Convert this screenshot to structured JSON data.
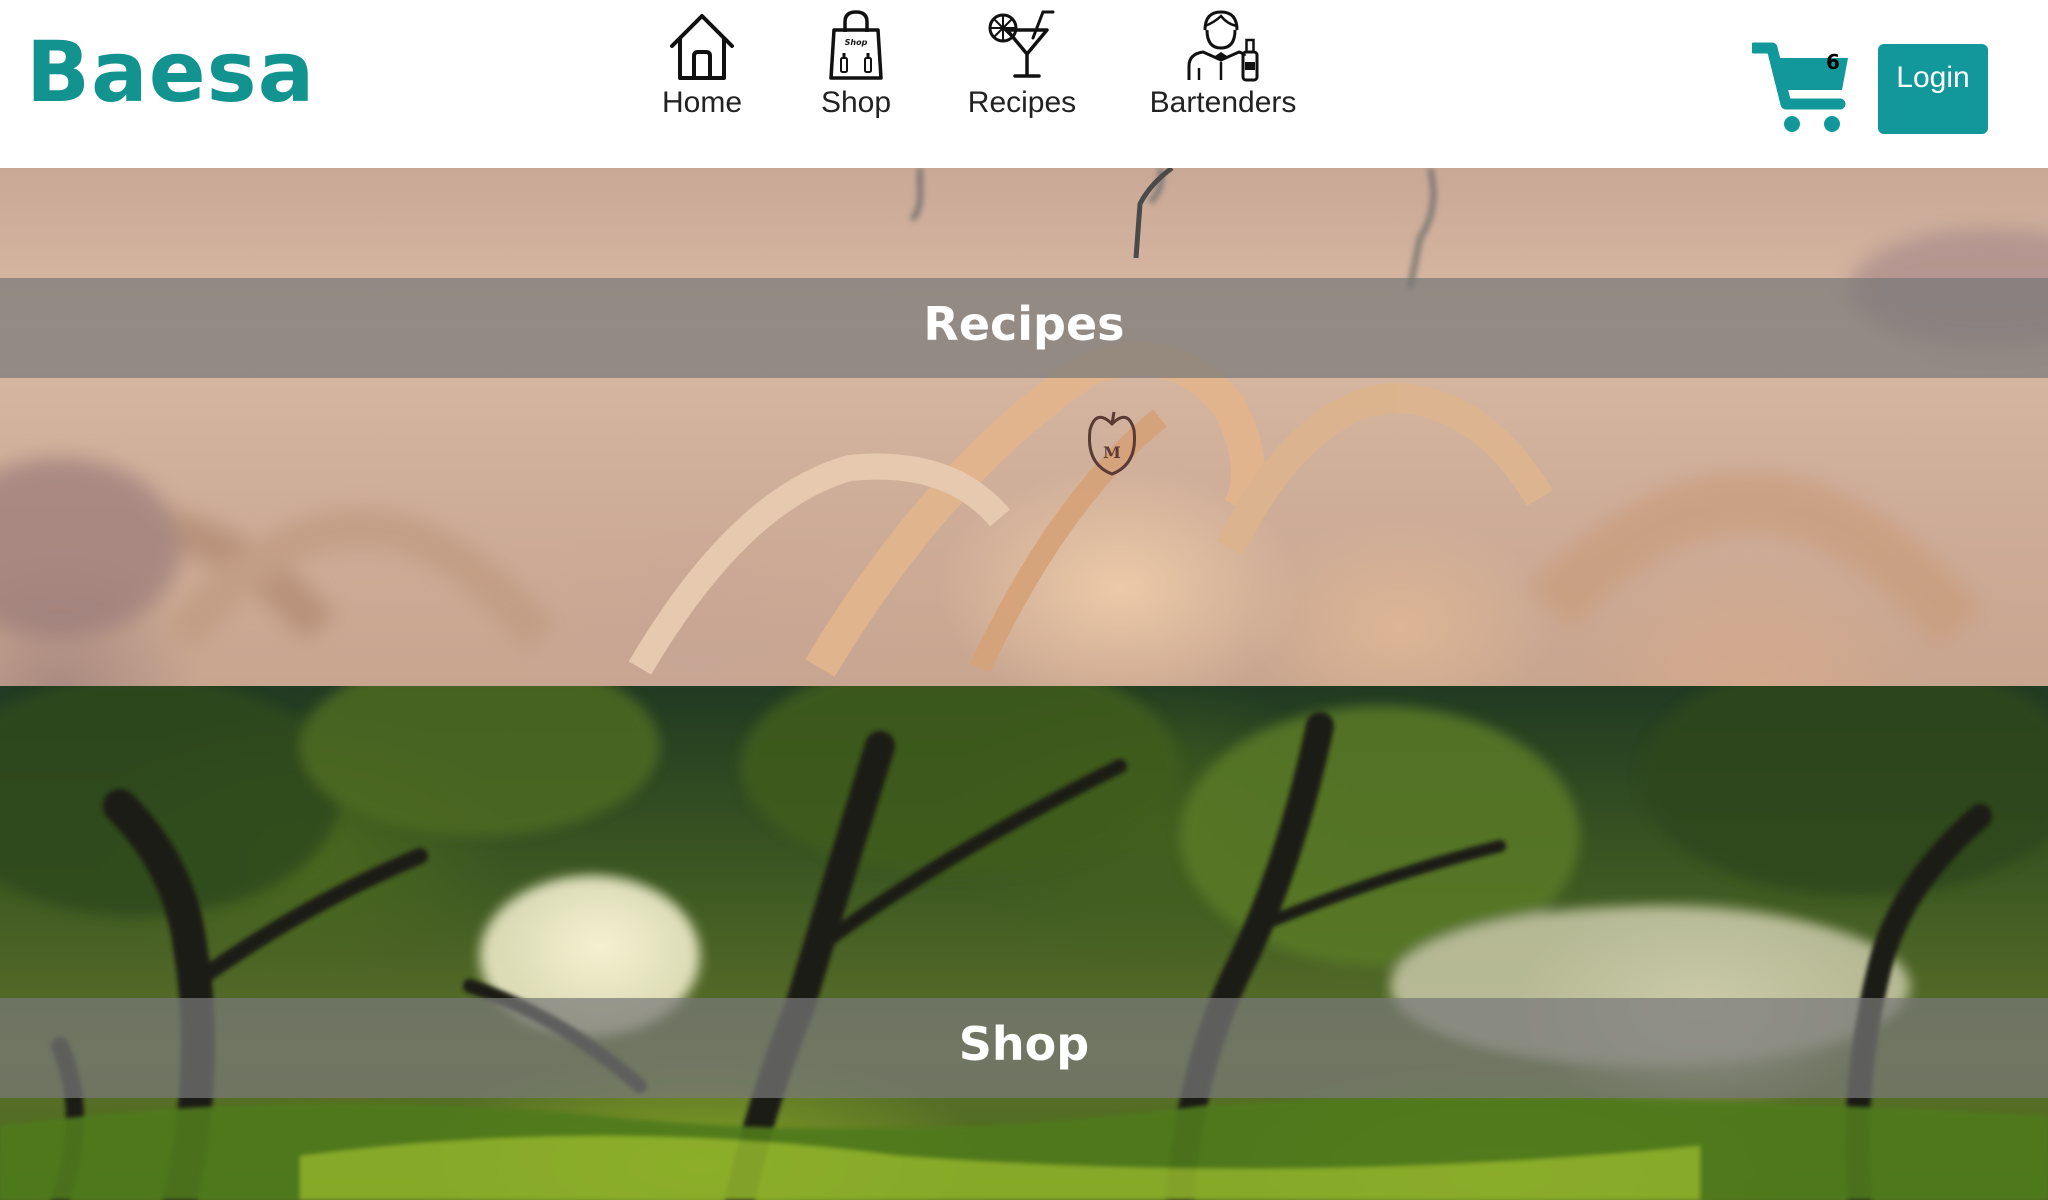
{
  "brand": {
    "name": "Baesa",
    "color": "#12938f"
  },
  "nav": {
    "items": [
      {
        "label": "Home",
        "icon": "house-icon"
      },
      {
        "label": "Shop",
        "icon": "shopping-bag-icon",
        "icon_text": "Shop"
      },
      {
        "label": "Recipes",
        "icon": "cocktail-glass-icon"
      },
      {
        "label": "Bartenders",
        "icon": "bartender-icon"
      }
    ]
  },
  "cart": {
    "icon": "cart-icon",
    "count": "6",
    "color": "#12989a"
  },
  "login": {
    "label": "Login",
    "color": "#12989a"
  },
  "banners": [
    {
      "title": "Recipes",
      "image": "wooden-hangers-photo"
    },
    {
      "title": "Shop",
      "image": "sunlit-trees-photo"
    }
  ]
}
